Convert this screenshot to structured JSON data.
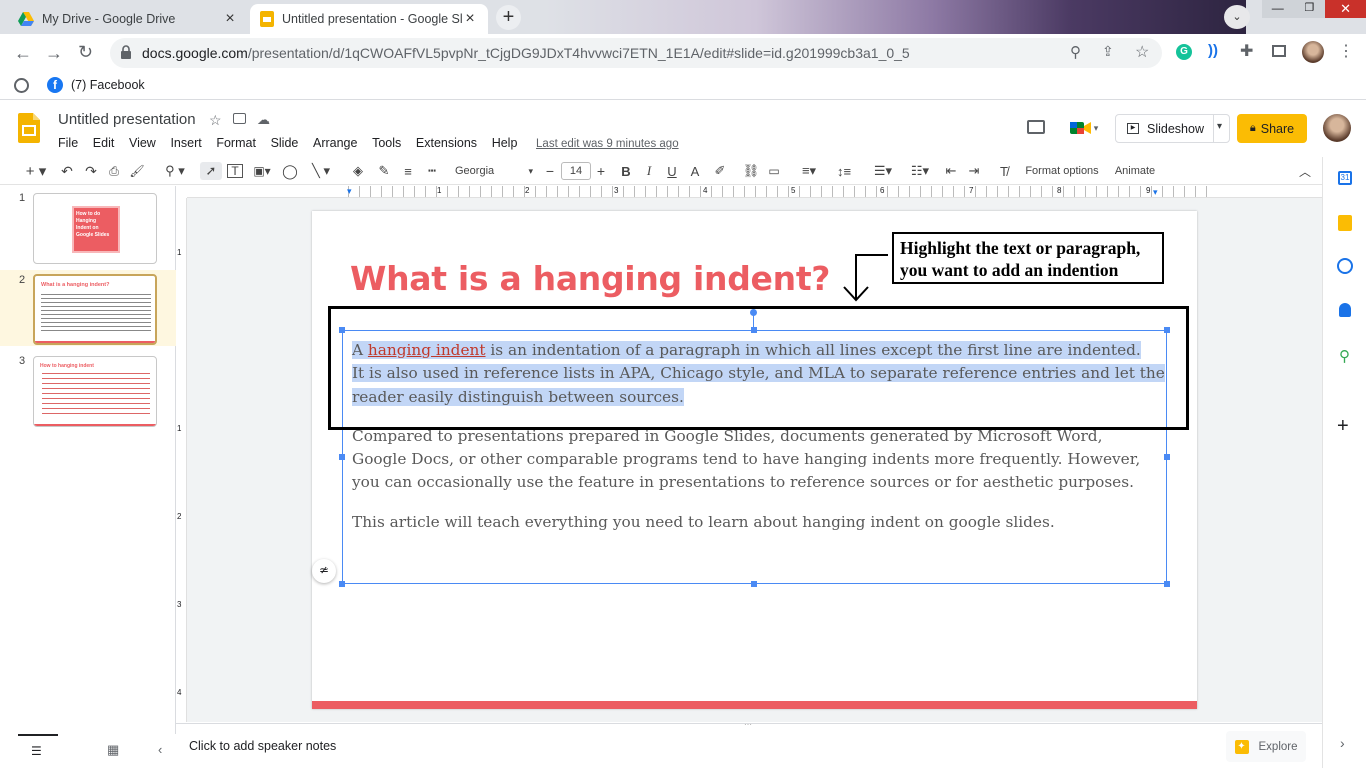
{
  "browser": {
    "tabs": [
      {
        "title": "My Drive - Google Drive",
        "active": false
      },
      {
        "title": "Untitled presentation - Google Sli",
        "active": true
      }
    ],
    "url_host": "docs.google.com",
    "url_path": "/presentation/d/1qCWOAFfVL5pvpNr_tCjgDG9JDxT4hvvwci7ETN_1E1A/edit#slide=id.g201999cb3a1_0_5",
    "bookmarks": [
      {
        "label": "(7) Facebook"
      }
    ]
  },
  "docs": {
    "title": "Untitled presentation",
    "menu": [
      "File",
      "Edit",
      "View",
      "Insert",
      "Format",
      "Slide",
      "Arrange",
      "Tools",
      "Extensions",
      "Help"
    ],
    "last_edit": "Last edit was 9 minutes ago",
    "slideshow_label": "Slideshow",
    "share_label": "Share",
    "toolbar": {
      "font": "Georgia",
      "font_size": "14",
      "format_options": "Format options",
      "animate": "Animate"
    },
    "ruler_h": [
      "1",
      "2",
      "3",
      "4",
      "5",
      "6",
      "7",
      "8",
      "9"
    ],
    "ruler_v": [
      "1",
      "1",
      "2",
      "3",
      "4"
    ]
  },
  "filmstrip": {
    "slides": [
      {
        "num": "1",
        "text": "How to do Hanging Indent on Google Slides"
      },
      {
        "num": "2",
        "text": "What is a hanging indent?"
      },
      {
        "num": "3",
        "text": "How to hanging indent"
      }
    ]
  },
  "slide": {
    "title": "What is a hanging indent?",
    "p1_a": "A ",
    "p1_link": "hanging indent",
    "p1_b": " is an indentation of a paragraph in which all lines except the first line are indented.",
    "p1_c": "It is also used in reference lists in APA, Chicago style, and MLA to separate reference entries and let the",
    "p1_d": "reader easily distinguish between sources.",
    "p2_a": "Compared to presentations prepared in Google Slides, documents generated by Microsoft Word,",
    "p2_b": "Google Docs, or other comparable programs tend to have hanging indents more frequently. However,",
    "p2_c": "you can occasionally use the feature in presentations to reference sources or for aesthetic purposes.",
    "p3": "This article will teach everything you need to learn about hanging indent on google slides."
  },
  "annotation": {
    "line1": "Highlight the text or paragraph,",
    "line2": "you want to add an indention"
  },
  "notes_placeholder": "Click to add speaker notes",
  "explore_label": "Explore",
  "colors": {
    "accent": "#ec5d62",
    "selection": "#c2d6f6",
    "share": "#fbbc04",
    "selection_box": "#4a8af4"
  }
}
